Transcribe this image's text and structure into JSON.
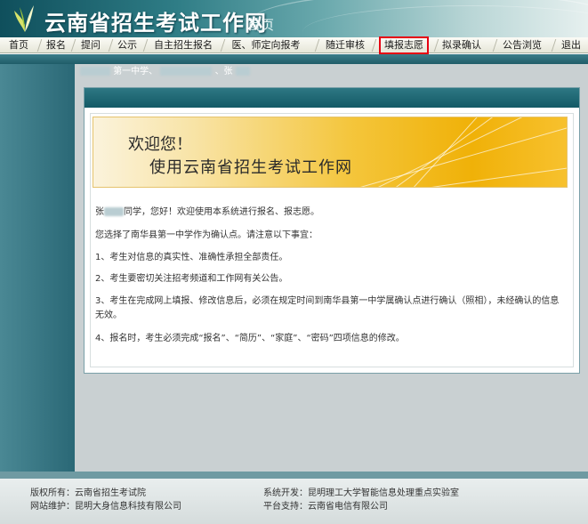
{
  "header": {
    "site_title": "云南省招生考试工作网",
    "home_label": "首页"
  },
  "nav": {
    "items": [
      {
        "label": "首页"
      },
      {
        "label": "报名"
      },
      {
        "label": "提问"
      },
      {
        "label": "公示"
      },
      {
        "label": "自主招生报名"
      },
      {
        "label": "医、师定向报考"
      },
      {
        "label": "随迁审核"
      },
      {
        "label": "填报志愿"
      },
      {
        "label": "拟录确认"
      },
      {
        "label": "公告浏览"
      },
      {
        "label": "退出"
      }
    ],
    "highlight_color": "#e60012"
  },
  "user_strip": {
    "school": "第一中学、",
    "name_prefix": "、张"
  },
  "banner": {
    "line1": "欢迎您！",
    "line2": "使用云南省招生考试工作网"
  },
  "content": {
    "greeting_prefix": "张",
    "greeting_suffix": "同学，您好！欢迎使用本系统进行报名、报志愿。",
    "notice": "您选择了南华县第一中学作为确认点。请注意以下事宜：",
    "item1": "1、考生对信息的真实性、准确性承担全部责任。",
    "item2": "2、考生要密切关注招考频道和工作网有关公告。",
    "item3": "3、考生在完成网上填报、修改信息后，必须在规定时间到南华县第一中学属确认点进行确认（照相），未经确认的信息无效。",
    "item4": "4、报名时，考生必须完成“报名”、“简历”、“家庭”、“密码”四项信息的修改。"
  },
  "footer": {
    "copyright_label": "版权所有：",
    "copyright_value": "云南省招生考试院",
    "maintain_label": "网站维护：",
    "maintain_value": "昆明大身信息科技有限公司",
    "dev_label": "系统开发：",
    "dev_value": "昆明理工大学智能信息处理重点实验室",
    "platform_label": "平台支持：",
    "platform_value": "云南省电信有限公司"
  }
}
